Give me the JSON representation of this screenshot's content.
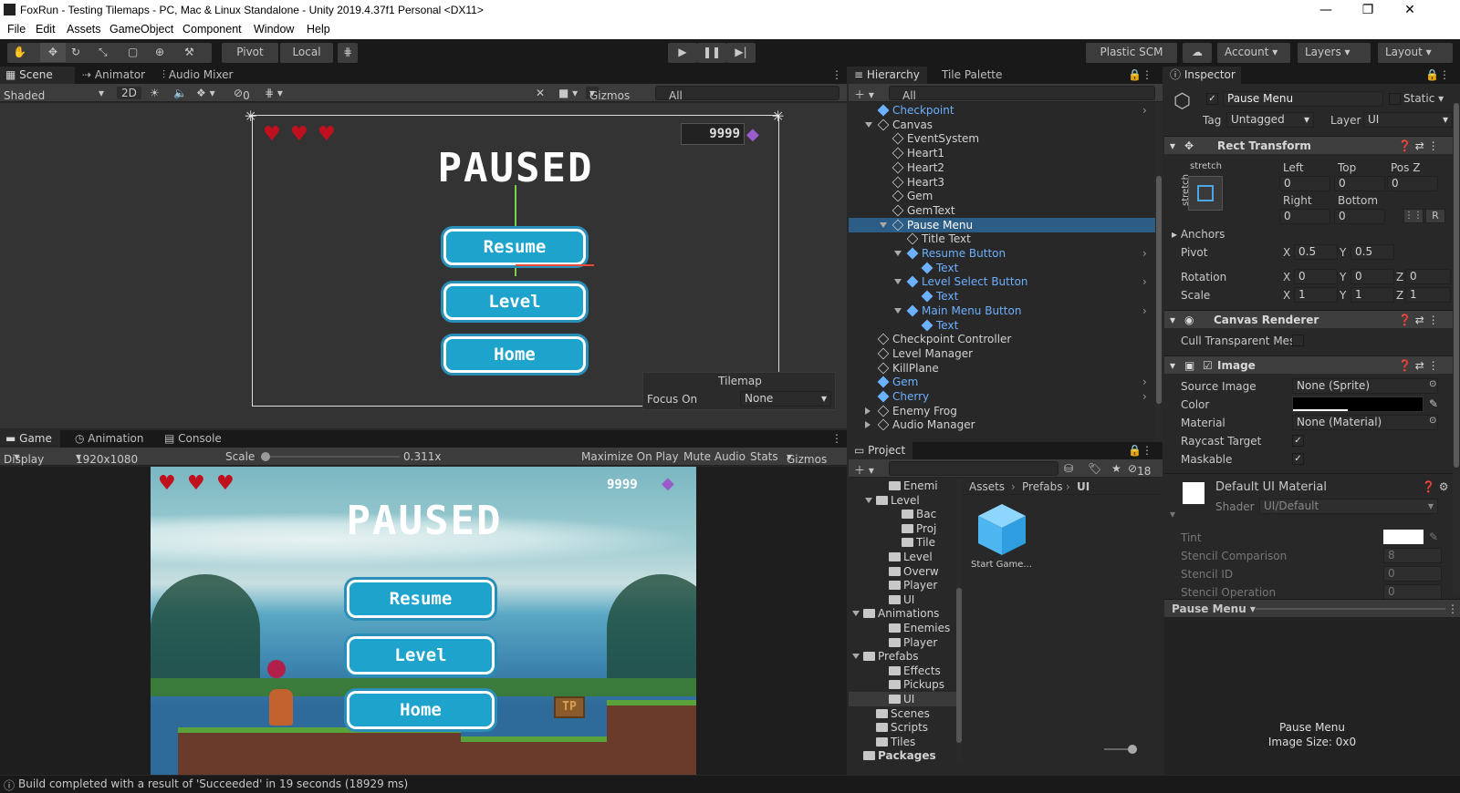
{
  "window": {
    "title": "FoxRun - Testing Tilemaps - PC, Mac & Linux Standalone - Unity 2019.4.37f1 Personal <DX11>",
    "minimize": "—",
    "maximize": "❐",
    "close": "✕"
  },
  "menu": [
    "File",
    "Edit",
    "Assets",
    "GameObject",
    "Component",
    "Window",
    "Help"
  ],
  "toolbar": {
    "pivot": "Pivot",
    "local": "Local",
    "plastic": "Plastic SCM",
    "account": "Account",
    "layers": "Layers",
    "layout": "Layout"
  },
  "scene": {
    "tabs": [
      "Scene",
      "Animator",
      "Audio Mixer"
    ],
    "shading": "Shaded",
    "mode2d": "2D",
    "hidden_count": "0",
    "gizmos": "Gizmos",
    "search_placeholder": "All",
    "paused": "PAUSED",
    "gem_count": "9999",
    "buttons": [
      "Resume",
      "Level",
      "Home"
    ],
    "overlay": {
      "title": "Tilemap",
      "focus_label": "Focus On",
      "focus_value": "None"
    }
  },
  "game": {
    "tabs": [
      "Game",
      "Animation",
      "Console"
    ],
    "display": "Display 1",
    "resolution": "1920x1080 (1920x1080)",
    "scale_label": "Scale",
    "scale_value": "0.311x",
    "toggles": [
      "Maximize On Play",
      "Mute Audio",
      "Stats",
      "Gizmos"
    ],
    "paused": "PAUSED",
    "gem_count": "9999",
    "buttons": [
      "Resume",
      "Level",
      "Home"
    ],
    "sign": "TP"
  },
  "hierarchy": {
    "tabs": [
      "Hierarchy",
      "Tile Palette"
    ],
    "search_placeholder": "All",
    "rows": [
      {
        "label": "Checkpoint",
        "indent": 0,
        "blue": true,
        "expand": "",
        "more": true
      },
      {
        "label": "Canvas",
        "indent": 0,
        "blue": false,
        "expand": "open",
        "more": false
      },
      {
        "label": "EventSystem",
        "indent": 1,
        "blue": false,
        "expand": "",
        "more": false
      },
      {
        "label": "Heart1",
        "indent": 1,
        "blue": false,
        "expand": "",
        "more": false
      },
      {
        "label": "Heart2",
        "indent": 1,
        "blue": false,
        "expand": "",
        "more": false
      },
      {
        "label": "Heart3",
        "indent": 1,
        "blue": false,
        "expand": "",
        "more": false
      },
      {
        "label": "Gem",
        "indent": 1,
        "blue": false,
        "expand": "",
        "more": false
      },
      {
        "label": "GemText",
        "indent": 1,
        "blue": false,
        "expand": "",
        "more": false
      },
      {
        "label": "Pause Menu",
        "indent": 1,
        "blue": false,
        "expand": "open",
        "more": false,
        "selected": true
      },
      {
        "label": "Title Text",
        "indent": 2,
        "blue": false,
        "expand": "",
        "more": false
      },
      {
        "label": "Resume Button",
        "indent": 2,
        "blue": true,
        "expand": "open",
        "more": true
      },
      {
        "label": "Text",
        "indent": 3,
        "blue": true,
        "expand": "",
        "more": false
      },
      {
        "label": "Level Select Button",
        "indent": 2,
        "blue": true,
        "expand": "open",
        "more": true
      },
      {
        "label": "Text",
        "indent": 3,
        "blue": true,
        "expand": "",
        "more": false
      },
      {
        "label": "Main Menu Button",
        "indent": 2,
        "blue": true,
        "expand": "open",
        "more": true
      },
      {
        "label": "Text",
        "indent": 3,
        "blue": true,
        "expand": "",
        "more": false
      },
      {
        "label": "Checkpoint Controller",
        "indent": 0,
        "blue": false,
        "expand": "",
        "more": false
      },
      {
        "label": "Level Manager",
        "indent": 0,
        "blue": false,
        "expand": "",
        "more": false
      },
      {
        "label": "KillPlane",
        "indent": 0,
        "blue": false,
        "expand": "",
        "more": false
      },
      {
        "label": "Gem",
        "indent": 0,
        "blue": true,
        "expand": "",
        "more": true
      },
      {
        "label": "Cherry",
        "indent": 0,
        "blue": true,
        "expand": "",
        "more": true
      },
      {
        "label": "Enemy Frog",
        "indent": 0,
        "blue": false,
        "expand": "closed",
        "more": false
      },
      {
        "label": "Audio Manager",
        "indent": 0,
        "blue": false,
        "expand": "closed",
        "more": false
      }
    ]
  },
  "project": {
    "tab": "Project",
    "hidden_count": "18",
    "breadcrumb": [
      "Assets",
      "Prefabs",
      "UI"
    ],
    "tree": [
      {
        "label": "Enemi",
        "indent": 2
      },
      {
        "label": "Level",
        "indent": 1,
        "open": true
      },
      {
        "label": "Bac",
        "indent": 3
      },
      {
        "label": "Proj",
        "indent": 3
      },
      {
        "label": "Tile",
        "indent": 3
      },
      {
        "label": "Level",
        "indent": 2
      },
      {
        "label": "Overw",
        "indent": 2
      },
      {
        "label": "Player",
        "indent": 2
      },
      {
        "label": "UI",
        "indent": 2
      },
      {
        "label": "Animations",
        "indent": 0,
        "open": true
      },
      {
        "label": "Enemies",
        "indent": 2
      },
      {
        "label": "Player",
        "indent": 2
      },
      {
        "label": "Prefabs",
        "indent": 0,
        "open": true
      },
      {
        "label": "Effects",
        "indent": 2
      },
      {
        "label": "Pickups",
        "indent": 2
      },
      {
        "label": "UI",
        "indent": 2,
        "selected": true
      },
      {
        "label": "Scenes",
        "indent": 1
      },
      {
        "label": "Scripts",
        "indent": 1
      },
      {
        "label": "Tiles",
        "indent": 1
      },
      {
        "label": "Packages",
        "indent": 0,
        "bold": true
      }
    ],
    "asset": "Start Game..."
  },
  "inspector": {
    "tab": "Inspector",
    "object": "Pause Menu",
    "static": "Static",
    "tag_label": "Tag",
    "tag": "Untagged",
    "layer_label": "Layer",
    "layer": "UI",
    "rect": {
      "title": "Rect Transform",
      "stretch": "stretch",
      "left_l": "Left",
      "top_l": "Top",
      "posz_l": "Pos Z",
      "left": "0",
      "top": "0",
      "posz": "0",
      "right_l": "Right",
      "bottom_l": "Bottom",
      "right": "0",
      "bottom": "0",
      "r": "R",
      "anchors": "Anchors",
      "pivot": "Pivot",
      "pivot_x": "0.5",
      "pivot_y": "0.5",
      "rotation": "Rotation",
      "rot_x": "0",
      "rot_y": "0",
      "rot_z": "0",
      "scale": "Scale",
      "sc_x": "1",
      "sc_y": "1",
      "sc_z": "1",
      "x": "X",
      "y": "Y",
      "z": "Z"
    },
    "canvas_renderer": {
      "title": "Canvas Renderer",
      "cull": "Cull Transparent Mes"
    },
    "image": {
      "title": "Image",
      "source_l": "Source Image",
      "source": "None (Sprite)",
      "color_l": "Color",
      "material_l": "Material",
      "material": "None (Material)",
      "raycast": "Raycast Target",
      "maskable": "Maskable"
    },
    "material": {
      "title": "Default UI Material",
      "shader_l": "Shader",
      "shader": "UI/Default",
      "tint": "Tint",
      "stencil_cmp": "Stencil Comparison",
      "stencil_cmp_v": "8",
      "stencil_id": "Stencil ID",
      "stencil_id_v": "0",
      "stencil_op": "Stencil Operation",
      "stencil_op_v": "0"
    },
    "footer_obj": "Pause Menu",
    "preview_name": "Pause Menu",
    "preview_size": "Image Size: 0x0"
  },
  "status": "Build completed with a result of 'Succeeded' in 19 seconds (18929 ms)"
}
